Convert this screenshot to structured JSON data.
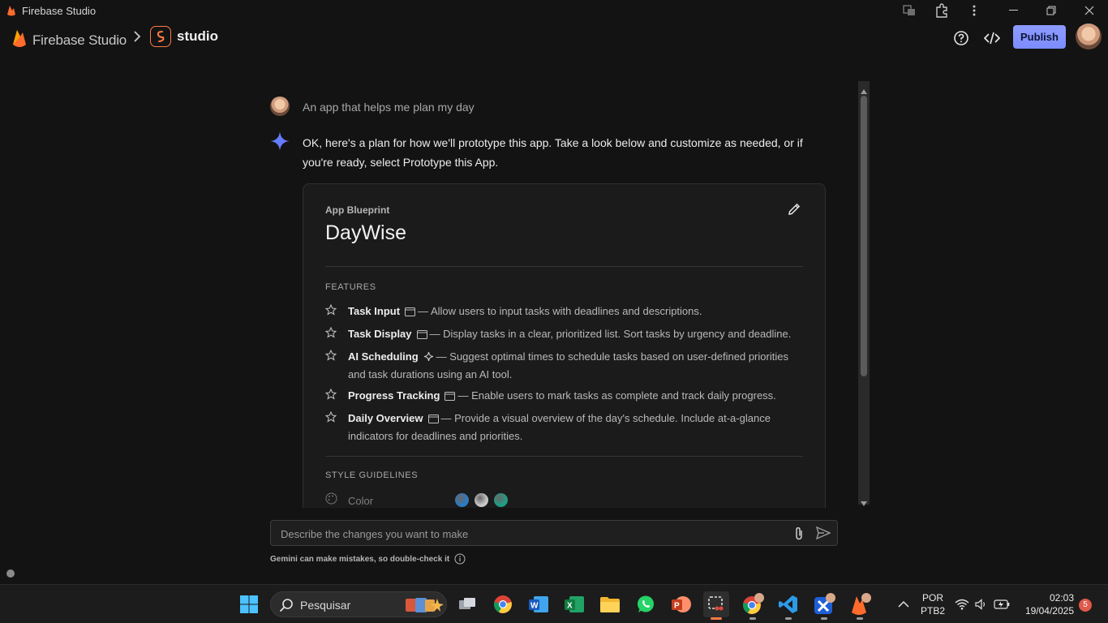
{
  "window": {
    "title": "Firebase Studio"
  },
  "header": {
    "brand": "Firebase Studio",
    "project": "studio",
    "publish_label": "Publish",
    "icons": [
      "help-icon",
      "code-icon"
    ]
  },
  "chat": {
    "user_message": "An app that helps me plan my day",
    "assistant_message": "OK, here's a plan for how we'll prototype this app. Take a look below and customize as needed, or if you're ready, select Prototype this App."
  },
  "blueprint": {
    "kicker": "App Blueprint",
    "title": "DayWise",
    "features_heading": "FEATURES",
    "features": [
      {
        "name": "Task Input",
        "icon": "window-icon",
        "description": "— Allow users to input tasks with deadlines and descriptions."
      },
      {
        "name": "Task Display",
        "icon": "window-icon",
        "description": "— Display tasks in a clear, prioritized list. Sort tasks by urgency and deadline."
      },
      {
        "name": "AI Scheduling",
        "icon": "sparkle-icon",
        "description": "— Suggest optimal times to schedule tasks based on user-defined priorities and task durations using an AI tool."
      },
      {
        "name": "Progress Tracking",
        "icon": "window-icon",
        "description": "— Enable users to mark tasks as complete and track daily progress."
      },
      {
        "name": "Daily Overview",
        "icon": "window-icon",
        "description": "— Provide a visual overview of the day's schedule. Include at-a-glance indicators for deadlines and priorities."
      }
    ],
    "style_heading": "STYLE GUIDELINES",
    "style_color_label": "Color",
    "swatches": [
      "#2b7bc4",
      "#c9c9c9",
      "#1e9e85"
    ]
  },
  "composer": {
    "placeholder": "Describe the changes you want to make",
    "disclaimer": "Gemini can make mistakes, so double-check it"
  },
  "taskbar": {
    "search_label": "Pesquisar",
    "language": "POR",
    "layout": "PTB2",
    "time": "02:03",
    "date": "19/04/2025",
    "notifications": "5"
  },
  "colors": {
    "accent": "#7c8cff",
    "firebase": "#ff7a45",
    "background": "#131313"
  }
}
